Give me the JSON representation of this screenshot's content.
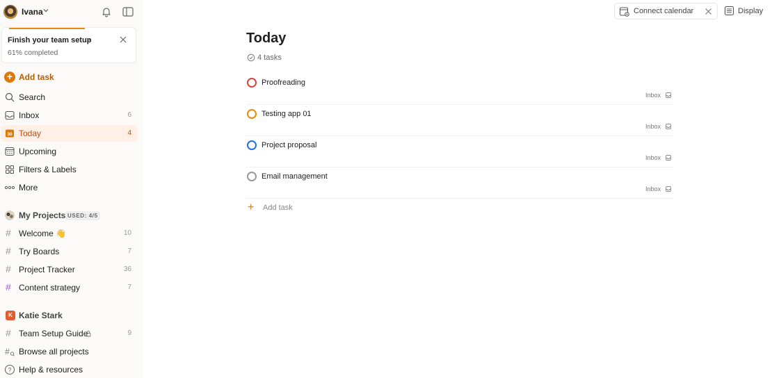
{
  "user": {
    "name": "Ivana"
  },
  "setup_card": {
    "title": "Finish your team setup",
    "chevron": ">",
    "subtitle": "61% completed",
    "progress": 0.61
  },
  "nav": {
    "add_task": "Add task",
    "search": "Search",
    "inbox": {
      "label": "Inbox",
      "count": "6"
    },
    "today": {
      "label": "Today",
      "count": "4",
      "icon_text": "30"
    },
    "upcoming": "Upcoming",
    "filters": "Filters & Labels",
    "more": "More"
  },
  "my_projects": {
    "title": "My Projects",
    "badge": "USED: 4/5",
    "items": [
      {
        "label": "Welcome 👋",
        "count": "10",
        "hash_color": "#999999"
      },
      {
        "label": "Try Boards",
        "count": "7",
        "hash_color": "#999999"
      },
      {
        "label": "Project Tracker",
        "count": "36",
        "hash_color": "#999999"
      },
      {
        "label": "Content strategy",
        "count": "7",
        "hash_color": "#9b5fd1"
      }
    ]
  },
  "team": {
    "avatar_letter": "K",
    "title": "Katie Stark",
    "items": [
      {
        "label": "Team Setup Guide",
        "count": "9"
      }
    ],
    "browse": "Browse all projects",
    "help": "Help & resources"
  },
  "topbar": {
    "connect_calendar": "Connect calendar",
    "display": "Display"
  },
  "main": {
    "title": "Today",
    "task_count": "4 tasks",
    "tasks": [
      {
        "name": "Proofreading",
        "project": "Inbox",
        "priority_color": "#d1453b"
      },
      {
        "name": "Testing app 01",
        "project": "Inbox",
        "priority_color": "#eb8909"
      },
      {
        "name": "Project proposal",
        "project": "Inbox",
        "priority_color": "#246fe0"
      },
      {
        "name": "Email management",
        "project": "Inbox",
        "priority_color": "#999999"
      }
    ],
    "add_task": "Add task"
  },
  "colors": {
    "accent": "#dc7a09",
    "today_bg": "#ffefe5",
    "today_text": "#c04d0f",
    "sidebar_bg": "#fcfaf8"
  }
}
